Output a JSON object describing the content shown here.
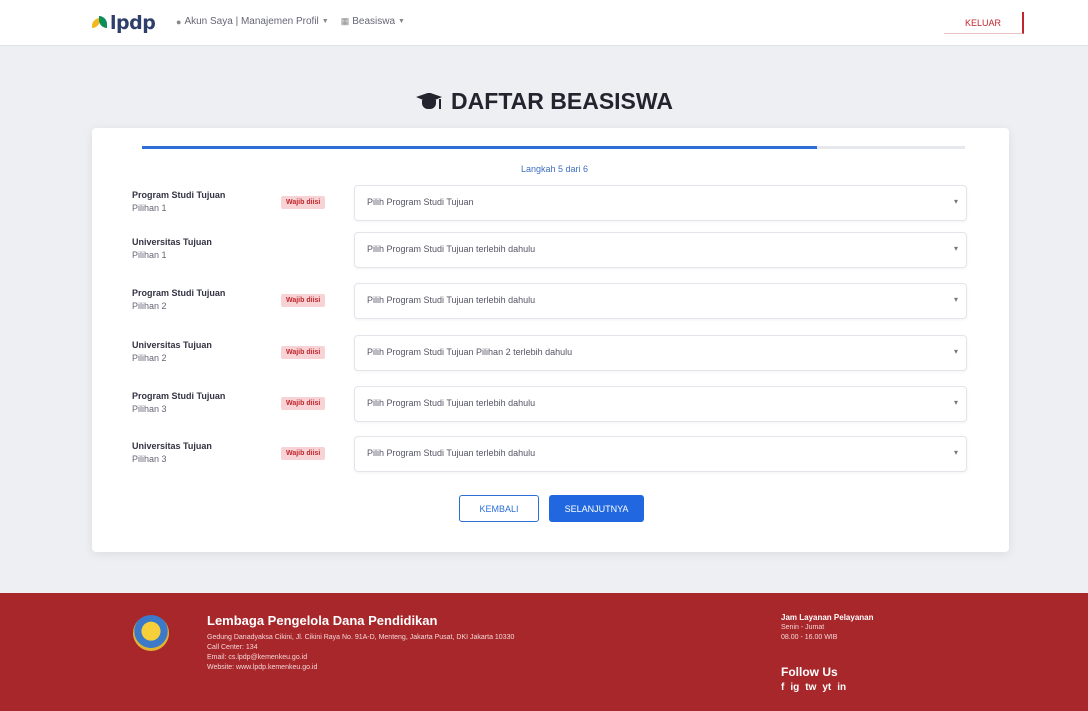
{
  "navbar": {
    "logo_text": "lpdp",
    "menu": [
      {
        "icon": "user-icon",
        "label": "Akun Saya | Manajemen Profil"
      },
      {
        "icon": "grid-icon",
        "label": "Beasiswa"
      }
    ],
    "logout_label": "KELUAR"
  },
  "page": {
    "title": "DAFTAR BEASISWA"
  },
  "form": {
    "progress_percent": 82,
    "step_label": "Langkah 5 dari 6",
    "rows": [
      {
        "label": "Program Studi Tujuan",
        "sub": "Pilihan 1",
        "badge": "Wajib diisi",
        "value": "Pilih Program Studi Tujuan"
      },
      {
        "label": "Universitas Tujuan",
        "sub": "Pilihan 1",
        "badge": "",
        "value": "Pilih Program Studi Tujuan terlebih dahulu"
      },
      {
        "label": "Program Studi Tujuan",
        "sub": "Pilihan 2",
        "badge": "Wajib diisi",
        "value": "Pilih Program Studi Tujuan terlebih dahulu"
      },
      {
        "label": "Universitas Tujuan",
        "sub": "Pilihan 2",
        "badge": "Wajib diisi",
        "value": "Pilih Program Studi Tujuan Pilihan 2 terlebih dahulu"
      },
      {
        "label": "Program Studi Tujuan",
        "sub": "Pilihan 3",
        "badge": "Wajib diisi",
        "value": "Pilih Program Studi Tujuan terlebih dahulu"
      },
      {
        "label": "Universitas Tujuan",
        "sub": "Pilihan 3",
        "badge": "Wajib diisi",
        "value": "Pilih Program Studi Tujuan terlebih dahulu"
      }
    ],
    "back_label": "KEMBALI",
    "next_label": "SELANJUTNYA"
  },
  "footer": {
    "org_name": "Lembaga Pengelola Dana Pendidikan",
    "lines": [
      "Gedung Danadyaksa Cikini, Jl. Cikini Raya No. 91A-D, Menteng, Jakarta Pusat, DKI Jakarta 10330",
      "Call Center: 134",
      "Email: cs.lpdp@kemenkeu.go.id",
      "Website: www.lpdp.kemenkeu.go.id"
    ],
    "right_title": "Jam Layanan Pelayanan",
    "right_lines": [
      "Senin - Jumat",
      "08.00 - 16.00 WIB"
    ],
    "follow_label": "Follow Us",
    "socials": [
      "f",
      "ig",
      "tw",
      "yt",
      "in"
    ]
  }
}
